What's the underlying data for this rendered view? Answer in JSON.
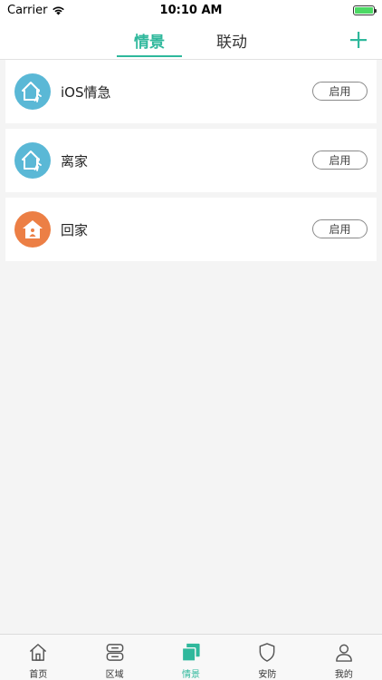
{
  "status_bar": {
    "carrier": "Carrier",
    "time": "10:10 AM",
    "battery_level": 1.0
  },
  "nav": {
    "tabs": [
      {
        "label": "情景",
        "active": true
      },
      {
        "label": "联动",
        "active": false
      }
    ],
    "add_icon": "plus-icon"
  },
  "scenes": [
    {
      "name": "iOS情急",
      "icon": "leave-home-icon",
      "icon_color": "#5ab8d6",
      "button_label": "启用"
    },
    {
      "name": "离家",
      "icon": "leave-home-icon",
      "icon_color": "#5ab8d6",
      "button_label": "启用"
    },
    {
      "name": "回家",
      "icon": "come-home-icon",
      "icon_color": "#ec7f45",
      "button_label": "启用"
    }
  ],
  "tab_bar": {
    "items": [
      {
        "label": "首页",
        "icon": "home-icon",
        "active": false
      },
      {
        "label": "区域",
        "icon": "area-icon",
        "active": false
      },
      {
        "label": "情景",
        "icon": "scene-icon",
        "active": true
      },
      {
        "label": "安防",
        "icon": "shield-icon",
        "active": false
      },
      {
        "label": "我的",
        "icon": "user-icon",
        "active": false
      }
    ]
  },
  "colors": {
    "accent": "#2fb89c",
    "background": "#f4f4f4",
    "card": "#ffffff"
  }
}
